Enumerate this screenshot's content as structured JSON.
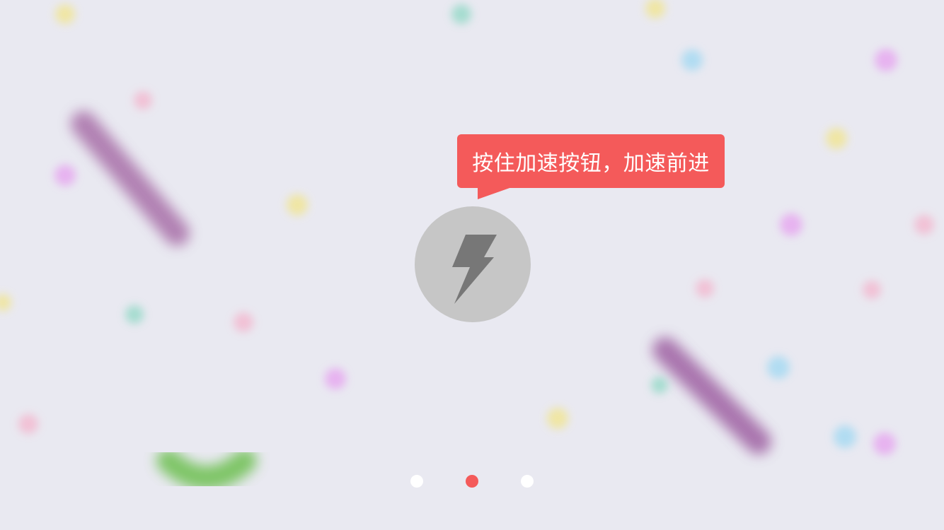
{
  "tutorial": {
    "tooltip_text": "按住加速按钮，加速前进"
  },
  "boost_button": {
    "icon": "lightning-bolt-icon",
    "color": "#c6c6c6",
    "icon_color": "#777777"
  },
  "pager": {
    "page_count": 3,
    "current_page": 2,
    "active_color": "#f45a5a",
    "inactive_color": "#ffffff"
  },
  "colors": {
    "background": "#e9e9f1",
    "accent": "#f45a5a",
    "snake_purple": "#a86fa8",
    "snake_green": "#6cbf50"
  }
}
